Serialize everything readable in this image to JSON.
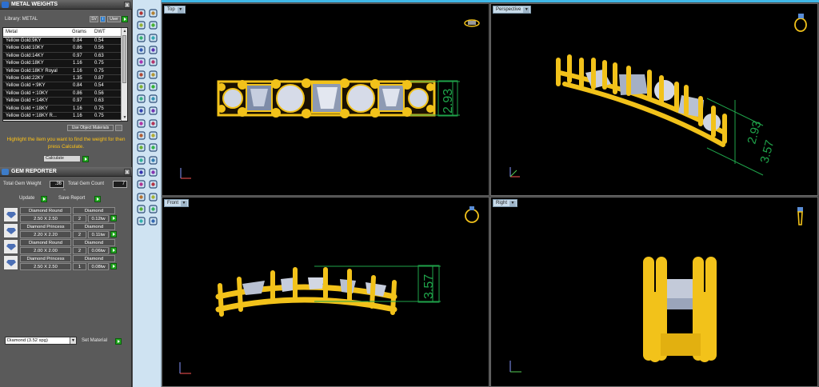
{
  "metal_weights": {
    "title": "METAL WEIGHTS",
    "library_label": "Library: METAL",
    "sv_button": "SV",
    "i_button": "i",
    "user_button": "User",
    "columns": [
      "Metal",
      "Grams",
      "DWT"
    ],
    "rows": [
      [
        "Yellow Gold:9KY",
        "0.84",
        "0.54"
      ],
      [
        "Yellow Gold:10KY",
        "0.86",
        "0.56"
      ],
      [
        "Yellow Gold:14KY",
        "0.97",
        "0.63"
      ],
      [
        "Yellow Gold:18KY",
        "1.16",
        "0.75"
      ],
      [
        "Yellow Gold:18KY Royal",
        "1.16",
        "0.75"
      ],
      [
        "Yellow Gold:22KY",
        "1.35",
        "0.87"
      ],
      [
        "Yellow Gold +:9KY",
        "0.84",
        "0.54"
      ],
      [
        "Yellow Gold +:10KY",
        "0.86",
        "0.56"
      ],
      [
        "Yellow Gold +:14KY",
        "0.97",
        "0.63"
      ],
      [
        "Yellow Gold +:18KY",
        "1.16",
        "0.75"
      ],
      [
        "Yellow Gold +:18KY R...",
        "1.16",
        "0.75"
      ]
    ],
    "use_object_materials": "Use Object Materials",
    "highlight_text": "Highlight the item you want to find the weight for then press Calculate.",
    "calculate_option": "Calculate"
  },
  "gem_reporter": {
    "title": "GEM REPORTER",
    "total_weight_label": "Total Gem Weight",
    "total_weight_value": ".36",
    "total_count_label": "Total Gem Count",
    "total_count_value": "7",
    "update_label": "Update",
    "save_report_label": "Save Report",
    "gems": [
      {
        "name": "Diamond Round",
        "material": "Diamond",
        "size": "2.50 X 2.50",
        "count": "2",
        "weight": "0.12tw"
      },
      {
        "name": "Diamond Princess",
        "material": "Diamond",
        "size": "2.20 X 2.20",
        "count": "2",
        "weight": "0.11tw"
      },
      {
        "name": "Diamond Round",
        "material": "Diamond",
        "size": "2.00 X 2.00",
        "count": "2",
        "weight": "0.06tw"
      },
      {
        "name": "Diamond Princess",
        "material": "Diamond",
        "size": "2.50 X 2.50",
        "count": "1",
        "weight": "0.08tw"
      }
    ],
    "material_select": "Diamond    (3.52 spg)",
    "set_material_label": "Set Material"
  },
  "viewports": {
    "top": {
      "label": "Top",
      "dimension": "2.93"
    },
    "perspective": {
      "label": "Perspective",
      "dimension_a": "2.93",
      "dimension_b": "3.57"
    },
    "front": {
      "label": "Front",
      "dimension": "3.57"
    },
    "right": {
      "label": "Right"
    }
  },
  "colors": {
    "accent": "#ffc316",
    "gold": "#f2c21a",
    "dimension": "#1fa34a",
    "go_green": "#21a81f"
  }
}
